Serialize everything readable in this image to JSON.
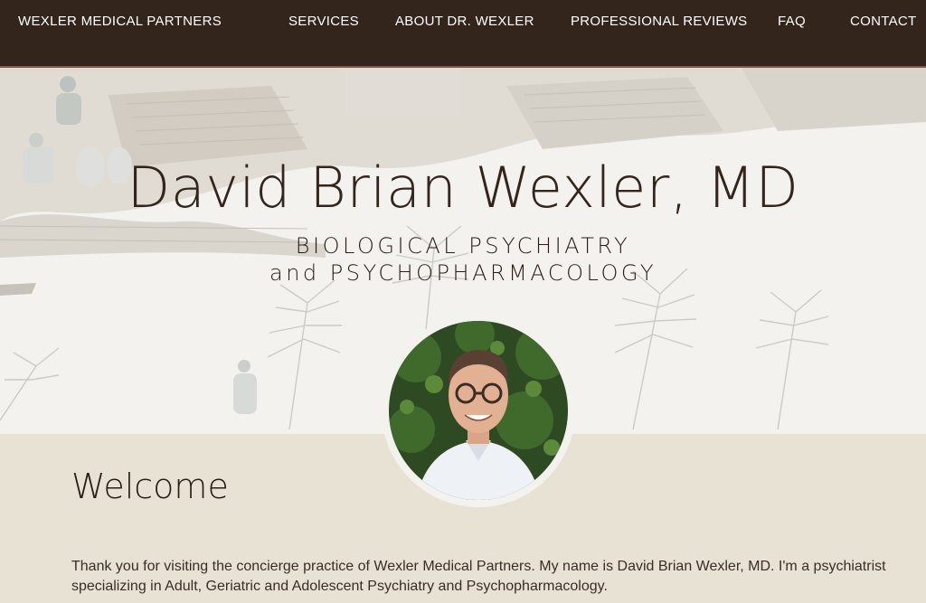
{
  "nav": {
    "brand": "WEXLER MEDICAL PARTNERS",
    "links": [
      "SERVICES",
      "ABOUT DR. WEXLER",
      "PROFESSIONAL REVIEWS",
      "FAQ",
      "CONTACT"
    ]
  },
  "hero": {
    "title": "David Brian Wexler, MD",
    "subtitle_line1": "BIOLOGICAL PSYCHIATRY",
    "subtitle_line2": "and  PSYCHOPHARMACOLOGY"
  },
  "welcome": {
    "heading": "Welcome",
    "intro": "Thank you for visiting the concierge practice of Wexler Medical Partners. My name is David Brian Wexler, MD. I'm a psychiatrist specializing in Adult, Geriatric and Adolescent Psychiatry and Psychopharmacology."
  },
  "colors": {
    "nav_bg": "#33251c",
    "hero_bg": "#f4f2ee",
    "lower_bg": "#e8e2d5",
    "text_dark": "#2a1d16"
  }
}
